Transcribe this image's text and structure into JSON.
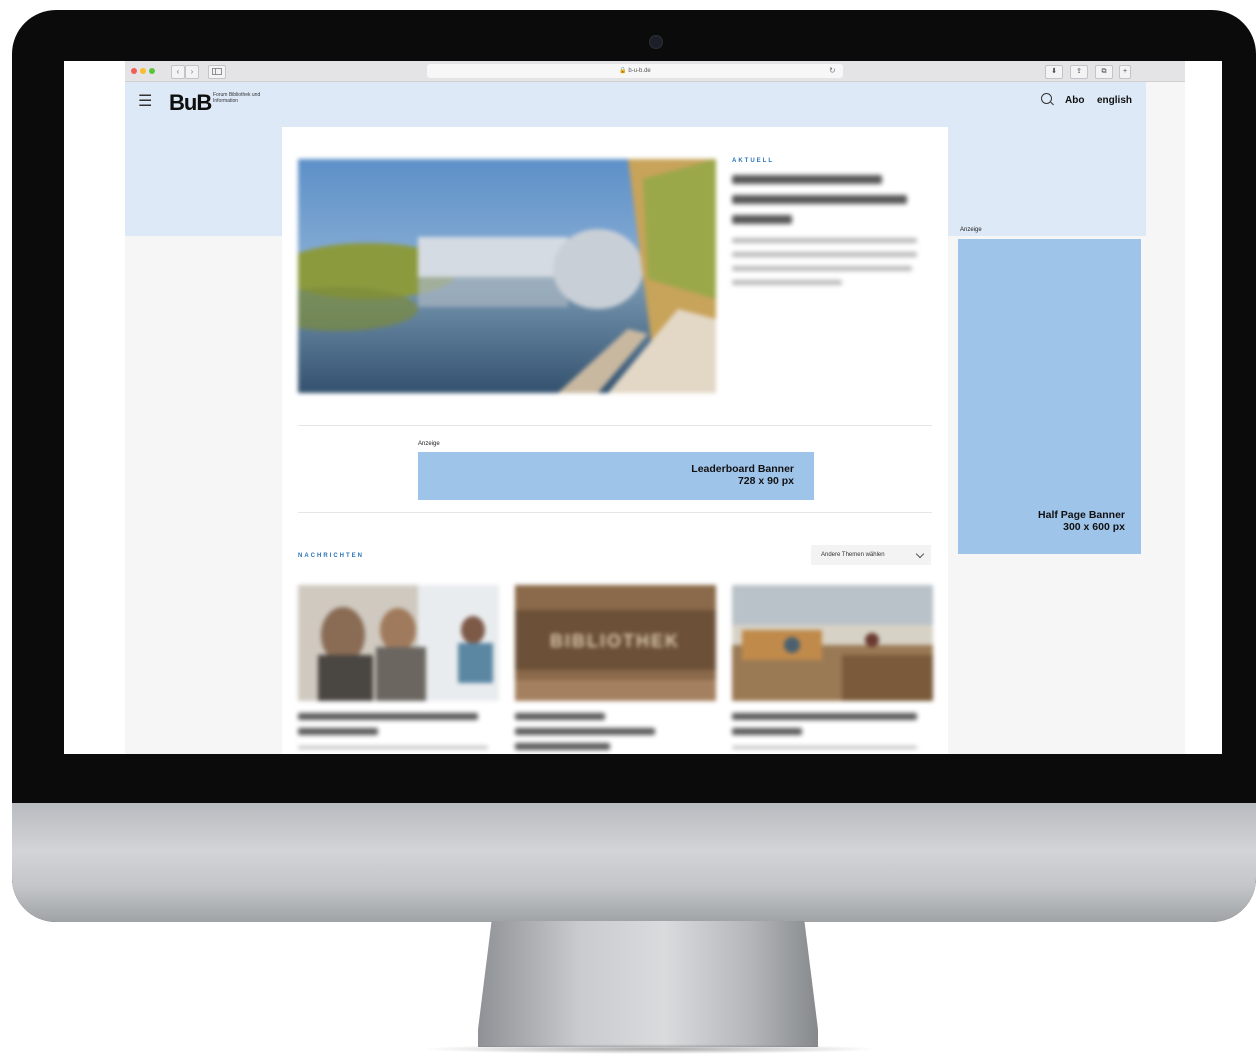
{
  "browser": {
    "url": "b-u-b.de",
    "nav_back": "‹",
    "nav_forward": "›"
  },
  "header": {
    "logo": "BuB",
    "logo_subtitle": "Forum Bibliothek und Information",
    "abo_label": "Abo",
    "language_label": "english",
    "icons": [
      "menu-icon",
      "search-icon"
    ]
  },
  "hero": {
    "kicker": "AKTUELL"
  },
  "ads": {
    "label": "Anzeige",
    "leaderboard_title": "Leaderboard Banner",
    "leaderboard_size": "728 x 90 px",
    "halfpage_title": "Half Page Banner",
    "halfpage_size": "300 x 600 px",
    "banner_color": "#9fc4ea"
  },
  "news": {
    "section_label": "NACHRICHTEN",
    "topics_button": "Andere Themen wählen",
    "card_2_sign": "BIBLIOTHEK"
  },
  "colors": {
    "header_band": "#dde9f7",
    "accent": "#2a73b8"
  }
}
